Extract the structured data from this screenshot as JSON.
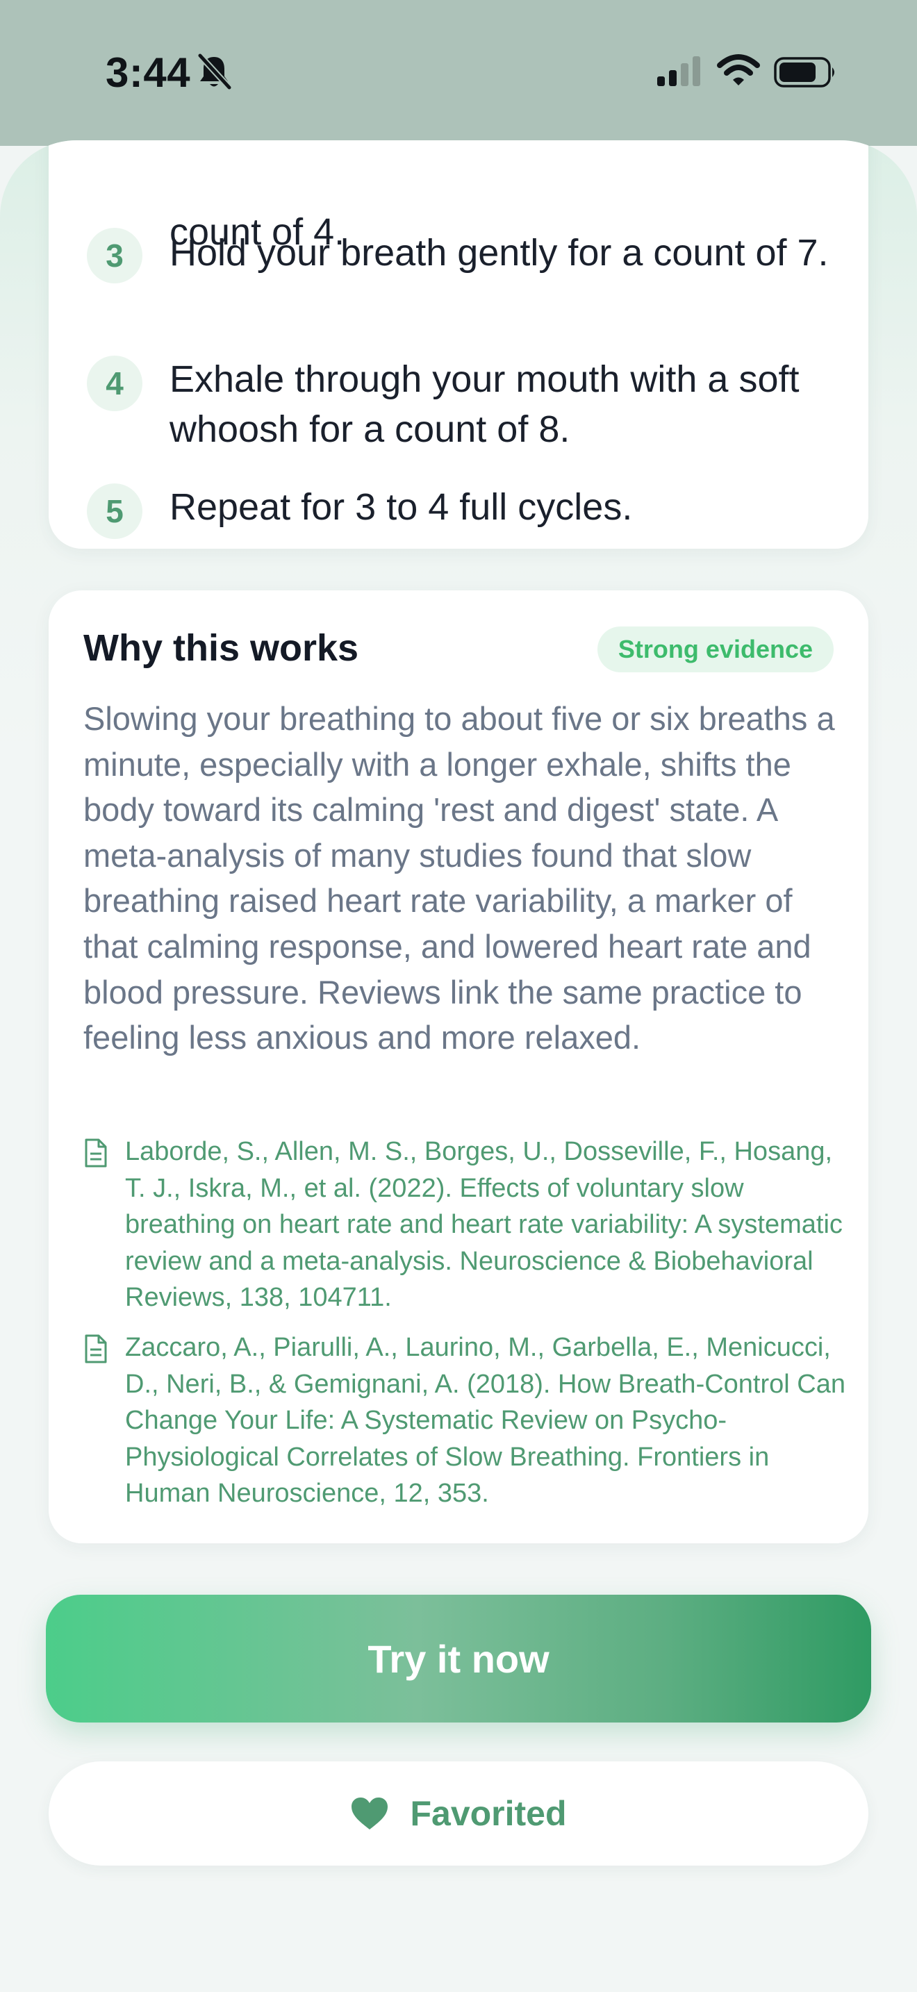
{
  "status_bar": {
    "time": "3:44",
    "icons": [
      "bell-slash-icon",
      "cellular-signal-icon",
      "wifi-icon",
      "battery-icon"
    ]
  },
  "steps": {
    "cut_off_text": "count of 4.",
    "items": [
      {
        "number": "3",
        "text": "Hold your breath gently for a count of 7."
      },
      {
        "number": "4",
        "text": "Exhale through your mouth with a soft whoosh for a count of 8."
      },
      {
        "number": "5",
        "text": "Repeat for 3 to 4 full cycles."
      }
    ]
  },
  "why": {
    "title": "Why this works",
    "badge": "Strong evidence",
    "body": "Slowing your breathing to about five or six breaths a minute, especially with a longer exhale, shifts the body toward its calming 'rest and digest' state. A meta-analysis of many studies found that slow breathing raised heart rate variability, a marker of that calming response, and lowered heart rate and blood pressure. Reviews link the same practice to feeling less anxious and more relaxed.",
    "references": [
      {
        "icon": "document-icon",
        "text": "Laborde, S., Allen, M. S., Borges, U., Dosseville, F., Hosang, T. J., Iskra, M., et al. (2022). Effects of voluntary slow breathing on heart rate and heart rate variability: A systematic review and a meta-analysis. Neuroscience & Biobehavioral Reviews, 138, 104711."
      },
      {
        "icon": "document-icon",
        "text": "Zaccaro, A., Piarulli, A., Laurino, M., Garbella, E., Menicucci, D., Neri, B., & Gemignani, A. (2018). How Breath-Control Can Change Your Life: A Systematic Review on Psycho-Physiological Correlates of Slow Breathing. Frontiers in Human Neuroscience, 12, 353."
      }
    ]
  },
  "actions": {
    "try_label": "Try it now",
    "favorite_label": "Favorited",
    "favorite_icon": "heart-icon"
  },
  "colors": {
    "accent": "#4f9a72",
    "badge_text": "#3dbb6c",
    "top_band": "#adc2b9"
  }
}
